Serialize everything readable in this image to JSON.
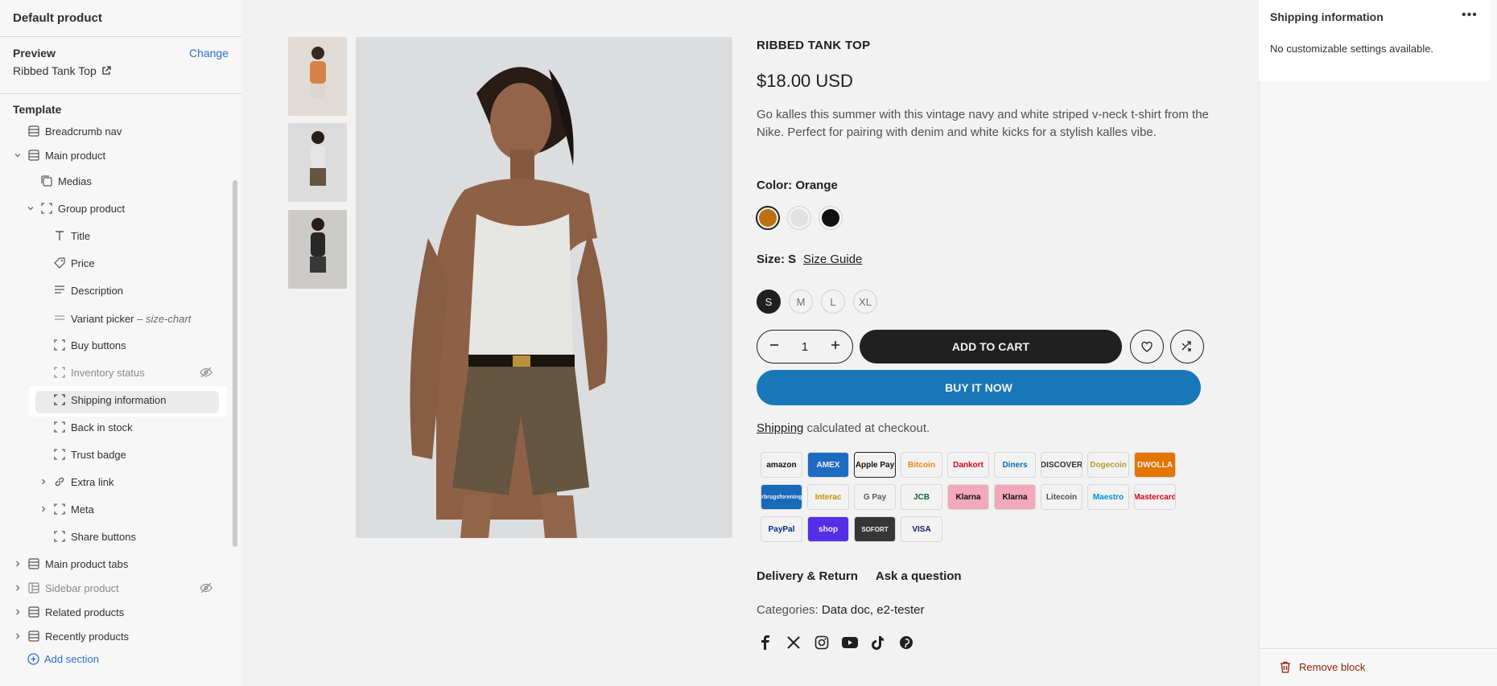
{
  "sidebar": {
    "title": "Default product",
    "preview_label": "Preview",
    "change_label": "Change",
    "preview_page": "Ribbed Tank Top",
    "template_label": "Template",
    "items": [
      {
        "label": "Breadcrumb nav",
        "icon": "section-icon"
      },
      {
        "label": "Main product",
        "icon": "section-icon"
      },
      {
        "label": "Medias",
        "icon": "media-icon"
      },
      {
        "label": "Group product",
        "icon": "group-icon"
      },
      {
        "label": "Title",
        "icon": "text-icon"
      },
      {
        "label": "Price",
        "icon": "tag-icon"
      },
      {
        "label": "Description",
        "icon": "paragraph-icon"
      },
      {
        "label": "Variant picker",
        "sub": " – size-chart",
        "icon": "variant-icon"
      },
      {
        "label": "Buy buttons",
        "icon": "block-icon"
      },
      {
        "label": "Inventory status",
        "icon": "block-icon"
      },
      {
        "label": "Shipping information",
        "icon": "block-icon"
      },
      {
        "label": "Back in stock",
        "icon": "block-icon"
      },
      {
        "label": "Trust badge",
        "icon": "block-icon"
      },
      {
        "label": "Extra link",
        "icon": "link-icon"
      },
      {
        "label": "Meta",
        "icon": "block-icon"
      },
      {
        "label": "Share buttons",
        "icon": "block-icon"
      },
      {
        "label": "Main product tabs",
        "icon": "section-icon"
      },
      {
        "label": "Sidebar product",
        "icon": "sidebar-icon"
      },
      {
        "label": "Related products",
        "icon": "section-icon"
      },
      {
        "label": "Recently products",
        "icon": "section-icon"
      }
    ],
    "add_section": "Add section"
  },
  "product": {
    "title": "RIBBED TANK TOP",
    "price": "$18.00 USD",
    "description": "Go kalles this summer with this vintage navy and white striped v-neck t-shirt from the Nike. Perfect for pairing with denim and white kicks for a stylish kalles vibe.",
    "color_label": "Color: Orange",
    "colors": [
      "#c97610",
      "#eeeeee",
      "#111111"
    ],
    "size_label": "Size: S",
    "size_guide": "Size Guide",
    "sizes": [
      "S",
      "M",
      "L",
      "XL"
    ],
    "quantity": "1",
    "add_to_cart": "ADD TO CART",
    "buy_now": "BUY IT NOW",
    "shipping_link": "Shipping",
    "shipping_rest": " calculated at checkout.",
    "payments": [
      "amazon",
      "AMEX",
      "Apple Pay",
      "Bitcoin",
      "Dankort",
      "Diners",
      "DISCOVER",
      "Dogecoin",
      "DWOLLA",
      "Forbrugsforeningen",
      "Interac",
      "G Pay",
      "JCB",
      "Klarna",
      "Klarna",
      "Litecoin",
      "Maestro",
      "Mastercard",
      "PayPal",
      "shop",
      "SOFORT",
      "VISA"
    ],
    "tab_delivery": "Delivery & Return",
    "tab_ask": "Ask a question",
    "categories_label": "Categories:",
    "categories_value": "Data doc, e2-tester",
    "social": [
      "facebook-icon",
      "x-icon",
      "instagram-icon",
      "youtube-icon",
      "tiktok-icon",
      "pinterest-icon"
    ]
  },
  "panel": {
    "title": "Shipping information",
    "more": "•••",
    "note": "No customizable settings available.",
    "remove": "Remove block"
  },
  "colors": {
    "accent": "#2c6ecb",
    "buy_now": "#1a7fc1",
    "danger": "#8e1f0b"
  }
}
